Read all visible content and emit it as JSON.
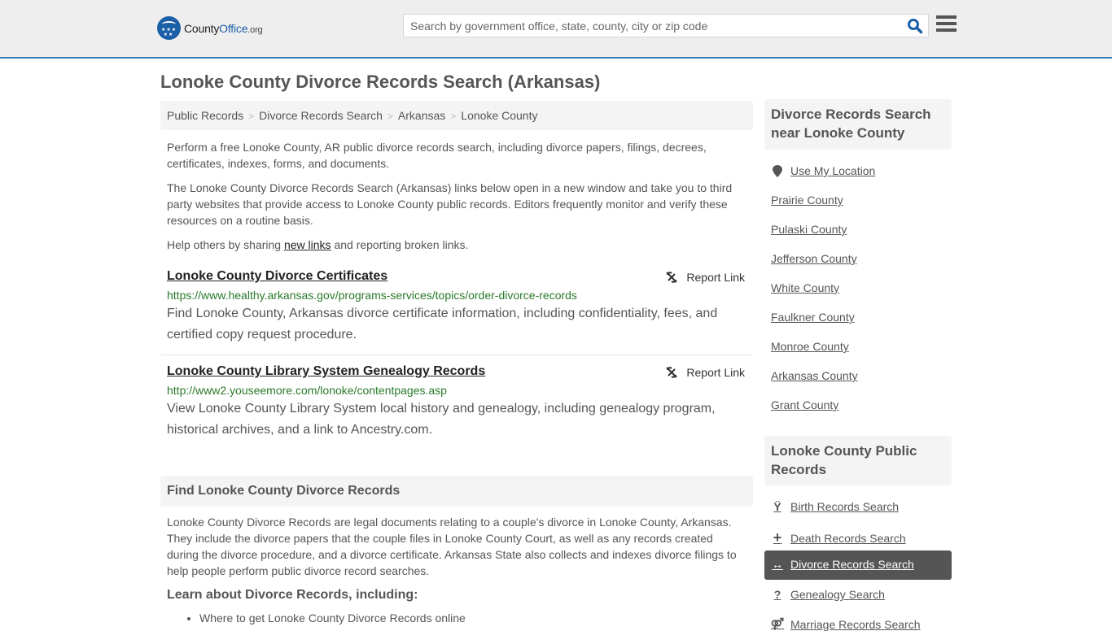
{
  "header": {
    "logo": {
      "name_part1": "County",
      "name_part2": "Office",
      "tld": ".org"
    },
    "search_placeholder": "Search by government office, state, county, city or zip code",
    "search_value": "",
    "search_icon": "search-icon",
    "menu_icon": "hamburger-menu-icon"
  },
  "page_title": "Lonoke County Divorce Records Search (Arkansas)",
  "breadcrumb": [
    "Public Records",
    "Divorce Records Search",
    "Arkansas",
    "Lonoke County"
  ],
  "breadcrumb_separator": ">",
  "intro": {
    "p1": "Perform a free Lonoke County, AR public divorce records search, including divorce papers, filings, decrees, certificates, indexes, forms, and documents.",
    "p2": "The Lonoke County Divorce Records Search (Arkansas) links below open in a new window and take you to third party websites that provide access to Lonoke County public records. Editors frequently monitor and verify these resources on a routine basis.",
    "p3_before": "Help others by sharing ",
    "p3_link": "new links",
    "p3_after": " and reporting broken links."
  },
  "results": [
    {
      "title": "Lonoke County Divorce Certificates",
      "url": "https://www.healthy.arkansas.gov/programs-services/topics/order-divorce-records",
      "description": "Find Lonoke County, Arkansas divorce certificate information, including confidentiality, fees, and certified copy request procedure.",
      "report_label": "Report Link"
    },
    {
      "title": "Lonoke County Library System Genealogy Records",
      "url": "http://www2.youseemore.com/lonoke/contentpages.asp",
      "description": "View Lonoke County Library System local history and genealogy, including genealogy program, historical archives, and a link to Ancestry.com.",
      "report_label": "Report Link"
    }
  ],
  "find_section": {
    "heading": "Find Lonoke County Divorce Records",
    "body": "Lonoke County Divorce Records are legal documents relating to a couple's divorce in Lonoke County, Arkansas. They include the divorce papers that the couple files in Lonoke County Court, as well as any records created during the divorce procedure, and a divorce certificate. Arkansas State also collects and indexes divorce filings to help people perform public divorce record searches.",
    "learn_heading": "Learn about Divorce Records, including:",
    "bullets": [
      "Where to get Lonoke County Divorce Records online"
    ]
  },
  "sidebar": {
    "nearby_heading": "Divorce Records Search near Lonoke County",
    "use_location": "Use My Location",
    "nearby": [
      "Prairie County",
      "Pulaski County",
      "Jefferson County",
      "White County",
      "Faulkner County",
      "Monroe County",
      "Arkansas County",
      "Grant County"
    ],
    "public_heading": "Lonoke County Public Records",
    "public_links": [
      {
        "label": "Birth Records Search",
        "icon": "child-icon",
        "active": false
      },
      {
        "label": "Death Records Search",
        "icon": "plus-icon",
        "active": false
      },
      {
        "label": "Divorce Records Search",
        "icon": "arrows-horizontal-icon",
        "active": true
      },
      {
        "label": "Genealogy Search",
        "icon": "question-icon",
        "active": false
      },
      {
        "label": "Marriage Records Search",
        "icon": "marriage-icon",
        "active": false
      }
    ]
  },
  "colors": {
    "accent": "#3a7bb5",
    "brand": "#1b5fa8",
    "url_green": "#2a7a2a",
    "active_bg": "#555555"
  }
}
